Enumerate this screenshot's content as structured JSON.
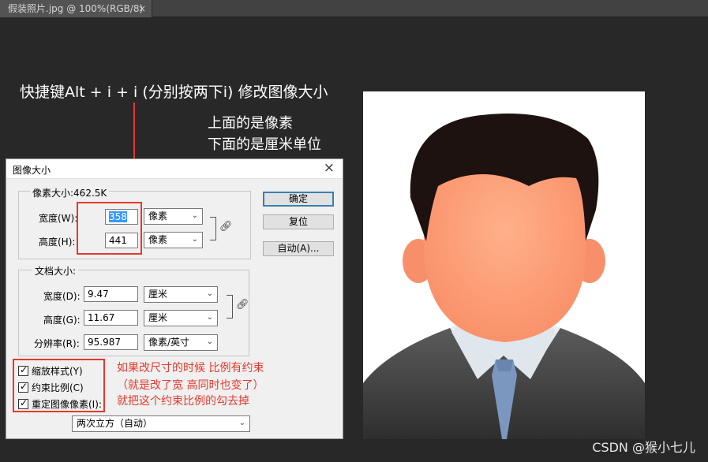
{
  "tab": {
    "title": "假装照片.jpg @ 100%(RGB/8)",
    "close": "×"
  },
  "annotations": {
    "shortcut": "快捷键Alt + i + i (分别按两下i) 修改图像大小",
    "line1": "上面的是像素",
    "line2": "下面的是厘米单位",
    "constraint1": "如果改尺寸的时候 比例有约束",
    "constraint2": "（就是改了宽 高同时也变了）",
    "constraint3": "就把这个约束比例的勾去掉"
  },
  "dialog": {
    "title": "图像大小",
    "close": "×",
    "pixel_size_label": "像素大小:462.5K",
    "width_label": "宽度(W):",
    "width_value": "358",
    "width_unit": "像素",
    "height_label": "高度(H):",
    "height_value": "441",
    "height_unit": "像素",
    "doc_size_label": "文档大小:",
    "doc_width_label": "宽度(D):",
    "doc_width_value": "9.47",
    "doc_width_unit": "厘米",
    "doc_height_label": "高度(G):",
    "doc_height_value": "11.67",
    "doc_height_unit": "厘米",
    "resolution_label": "分辨率(R):",
    "resolution_value": "95.987",
    "resolution_unit": "像素/英寸",
    "ok_button": "确定",
    "reset_button": "复位",
    "auto_button": "自动(A)...",
    "scale_styles": "缩放样式(Y)",
    "constrain_proportions": "约束比例(C)",
    "resample": "重定图像像素(I):",
    "resample_method": "两次立方（自动）"
  },
  "watermark": "CSDN @猴小七儿"
}
